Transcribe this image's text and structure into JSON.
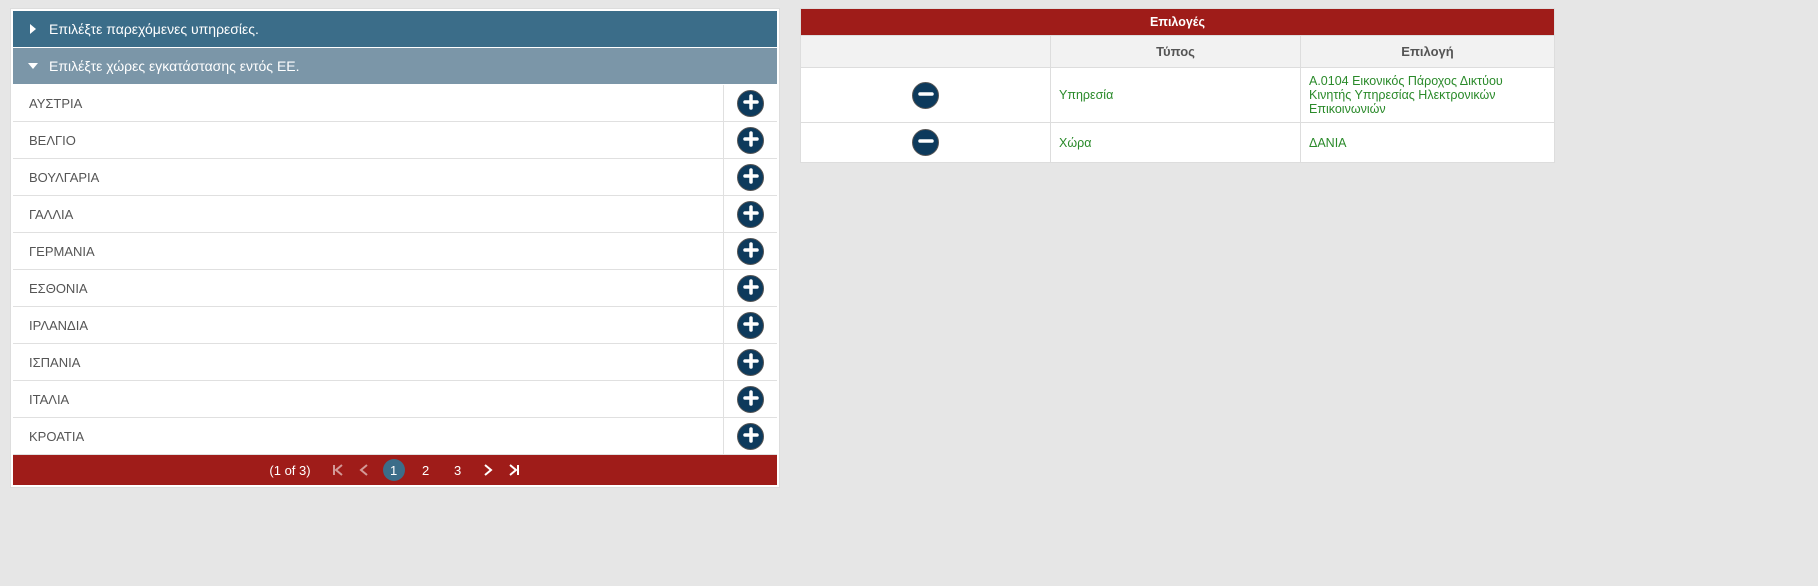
{
  "left": {
    "accordion1": "Επιλέξτε παρεχόμενες υπηρεσίες.",
    "accordion2": "Επιλέξτε χώρες εγκατάστασης εντός ΕΕ.",
    "countries": [
      "ΑΥΣΤΡΙΑ",
      "ΒΕΛΓΙΟ",
      "ΒΟΥΛΓΑΡΙΑ",
      "ΓΑΛΛΙΑ",
      "ΓΕΡΜΑΝΙΑ",
      "ΕΣΘΟΝΙΑ",
      "ΙΡΛΑΝΔΙΑ",
      "ΙΣΠΑΝΙΑ",
      "ΙΤΑΛΙΑ",
      "ΚΡΟΑΤΙΑ"
    ],
    "paginator": {
      "info": "(1 of 3)",
      "pages": [
        "1",
        "2",
        "3"
      ]
    }
  },
  "right": {
    "header": "Επιλογές",
    "columns": {
      "type": "Τύπος",
      "choice": "Επιλογή"
    },
    "rows": [
      {
        "type": "Υπηρεσία",
        "choice": "A.0104 Εικονικός Πάροχος Δικτύου Κινητής Υπηρεσίας Ηλεκτρονικών Επικοινωνιών"
      },
      {
        "type": "Χώρα",
        "choice": "ΔΑΝΙΑ"
      }
    ]
  }
}
